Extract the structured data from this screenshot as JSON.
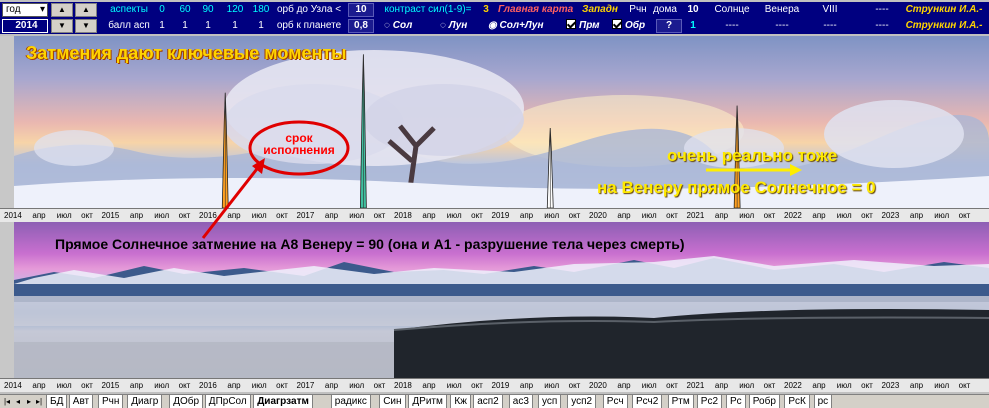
{
  "row1": {
    "period_select": "год",
    "aspects_label": "аспекты",
    "aspects": [
      "0",
      "60",
      "90",
      "120",
      "180"
    ],
    "orb_node_label": "орб до Узла <",
    "orb_node_value": "10",
    "contrast_label": "контраст сил(1-9)=",
    "contrast_value": "3",
    "main_map": "Главная карта",
    "west": "Западн",
    "rchn": "Рчн",
    "houses_label": "дома",
    "houses_value": "10",
    "sun": "Солнце",
    "venus": "Венера",
    "house_roman": "VIII",
    "dashes": "----",
    "author": "Стрункин И.А.-"
  },
  "row2": {
    "year": "2014",
    "points_label": "балл асп",
    "points": [
      "1",
      "1",
      "1",
      "1",
      "1"
    ],
    "orb_planet_label": "орб к планете",
    "orb_planet_value": "0,8",
    "opt_sun": "Сол",
    "opt_moon": "Лун",
    "opt_sunmoon": "Сол+Лун",
    "chk_direct": "Прм",
    "chk_reverse": "Обр",
    "question": "?",
    "one": "1",
    "dashes": "----",
    "author": "Стрункин И.А.-"
  },
  "chart_title": "Затмения дают ключевые моменты",
  "oval_note": "срок исполнения",
  "note_real": "очень реально тоже",
  "note_venus": "на Венеру прямое Солнечное = 0",
  "note_main": "Прямое Солнечное затмение на А8 Венеру = 90 (она и А1 - разрушение тела через смерть)",
  "axis": {
    "years": [
      "2014",
      "2015",
      "2016",
      "2017",
      "2018",
      "2019",
      "2020",
      "2021",
      "2022",
      "2023"
    ],
    "months": [
      "апр",
      "июл",
      "окт"
    ]
  },
  "chart_data": {
    "type": "bar",
    "x_unit": "date",
    "xlim": [
      "2014-01",
      "2024-01"
    ],
    "series": [
      {
        "x": "2016-03",
        "y": 0.72,
        "color": "#ffa020"
      },
      {
        "x": "2017-08",
        "y": 0.96,
        "color": "#40c0a0"
      },
      {
        "x": "2019-07",
        "y": 0.5,
        "color": "#ffffff"
      },
      {
        "x": "2021-06",
        "y": 0.64,
        "color": "#ffa020"
      }
    ],
    "annotations": [
      "Затмения дают ключевые моменты",
      "срок исполнения",
      "очень реально тоже",
      "на Венеру прямое Солнечное = 0",
      "Прямое Солнечное затмение на А8 Венеру = 90 (она и А1 - разрушение тела через смерть)"
    ]
  },
  "tabs": [
    "БД",
    "Авт",
    "Рчн",
    "Диагр",
    "ДОбр",
    "ДПрСол",
    "Диагрзатм",
    "радикс",
    "Син",
    "ДРитм",
    "Кж",
    "асп2",
    "ас3",
    "усп",
    "усп2",
    "Рсч",
    "Рсч2",
    "Ртм",
    "Рс2",
    "Рс",
    "Робр",
    "РсК",
    "рс"
  ],
  "active_tab": "Диагрзатм",
  "colors": {
    "header_bg": "#000080",
    "accent_yellow": "#ffd400",
    "annotation_red": "#ff0000"
  }
}
